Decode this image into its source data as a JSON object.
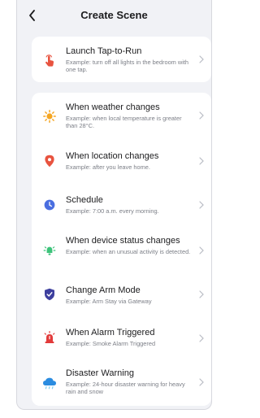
{
  "header": {
    "title": "Create Scene",
    "back_icon": "chevron-left-icon"
  },
  "top_card": {
    "items": [
      {
        "title": "Launch Tap-to-Run",
        "desc": "Example: turn off all lights in the bedroom with one tap.",
        "icon": "tap-hand-icon",
        "color": "#e8533f"
      }
    ]
  },
  "conditions": {
    "items": [
      {
        "title": "When weather changes",
        "desc": "Example: when local temperature is greater than 28°C.",
        "icon": "sun-icon",
        "color": "#f5a623"
      },
      {
        "title": "When location changes",
        "desc": "Example: after you leave home.",
        "icon": "location-pin-icon",
        "color": "#e8533f"
      },
      {
        "title": "Schedule",
        "desc": "Example: 7:00 a.m. every morning.",
        "icon": "clock-icon",
        "color": "#4a6ee0"
      },
      {
        "title": "When device status changes",
        "desc": "Example: when an unusual activity is detected.",
        "icon": "device-status-icon",
        "color": "#3cc37a"
      },
      {
        "title": "Change Arm Mode",
        "desc": "Example: Arm Stay via Gateway",
        "icon": "shield-check-icon",
        "color": "#3d3f9e"
      },
      {
        "title": "When Alarm Triggered",
        "desc": "Example: Smoke Alarm Triggered",
        "icon": "alarm-siren-icon",
        "color": "#e23b3b"
      },
      {
        "title": "Disaster Warning",
        "desc": "Example: 24-hour disaster warning for heavy rain and snow",
        "icon": "rain-cloud-icon",
        "color": "#2a8ce0"
      }
    ]
  }
}
